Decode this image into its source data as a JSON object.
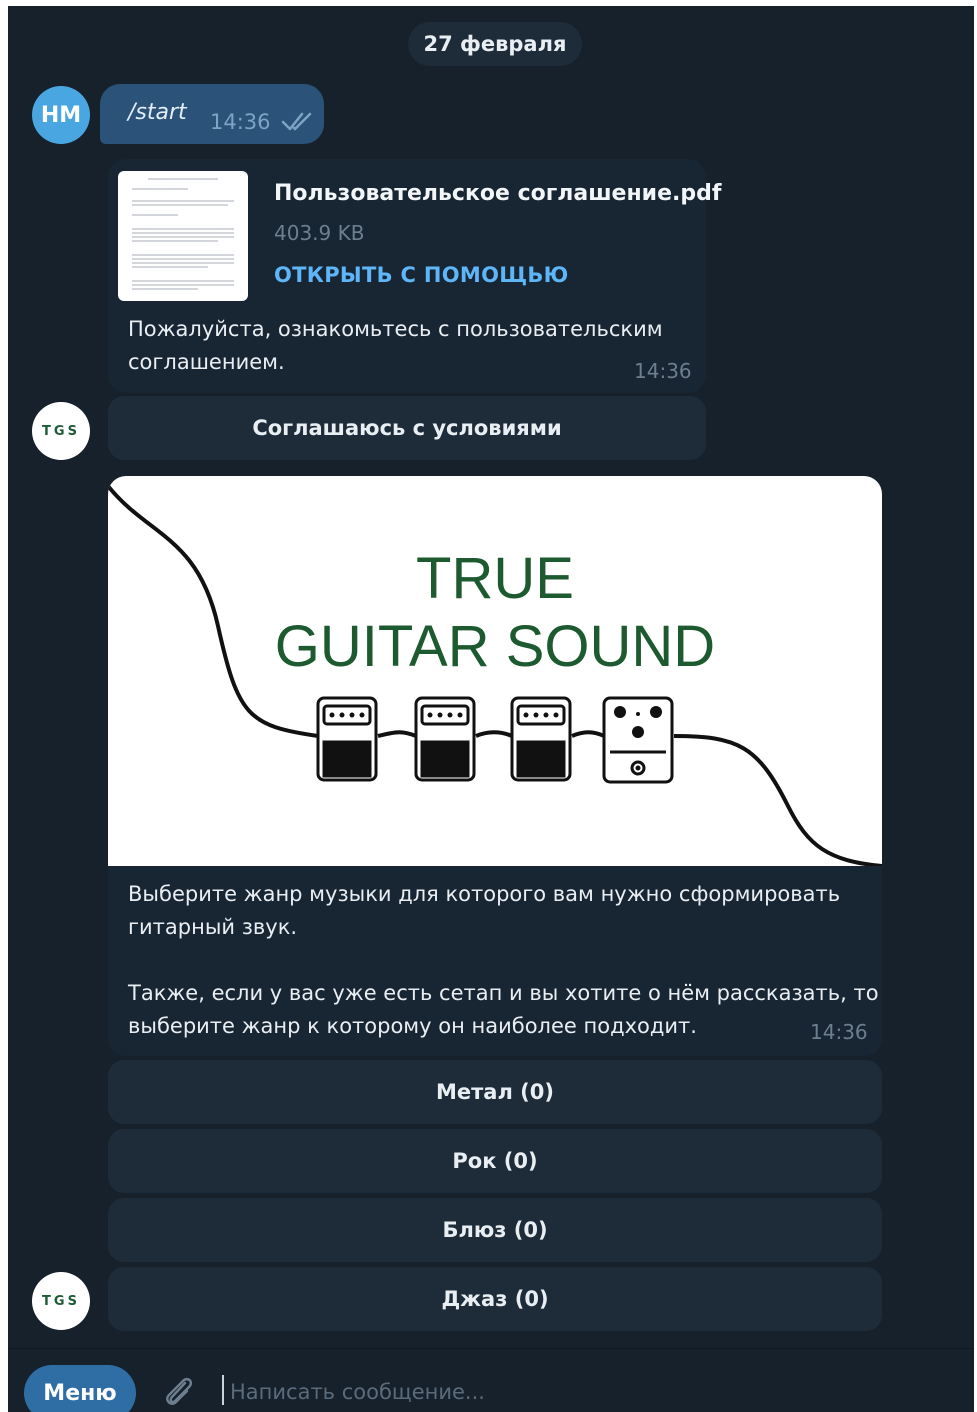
{
  "chat": {
    "date": "27 февраля",
    "user_avatar": "НМ",
    "bot_avatar": "TGS",
    "outgoing": {
      "text": "/start",
      "time": "14:36",
      "status_icon": "double-check-icon"
    },
    "document": {
      "file_name": "Пользовательское соглашение.pdf",
      "file_size": "403.9 KB",
      "open_with": "ОТКРЫТЬ С ПОМОЩЬЮ",
      "caption_line1": "Пожалуйста, ознакомьтесь с пользовательским",
      "caption_line2": "соглашением.",
      "time": "14:36"
    },
    "agree_button": "Соглашаюсь с условиями",
    "photo_message": {
      "image_title_line1": "TRUE",
      "image_title_line2": "GUITAR SOUND",
      "text_line1": "Выберите жанр музыки для которого вам нужно сформировать",
      "text_line2": "гитарный звук.",
      "text_line3": "Также, если у вас уже есть сетап и вы хотите о нём рассказать, то",
      "text_line4": "выберите жанр к которому он наиболее подходит.",
      "time": "14:36"
    },
    "genre_buttons": [
      "Метал (0)",
      "Рок (0)",
      "Блюз (0)",
      "Джаз (0)"
    ]
  },
  "input_bar": {
    "menu_label": "Меню",
    "placeholder": "Написать сообщение..."
  },
  "colors": {
    "background": "#17212b",
    "bubble_in": "#182533",
    "bubble_out": "#2b5278",
    "accent": "#5eb5f7",
    "logo_green": "#1d5a30"
  }
}
